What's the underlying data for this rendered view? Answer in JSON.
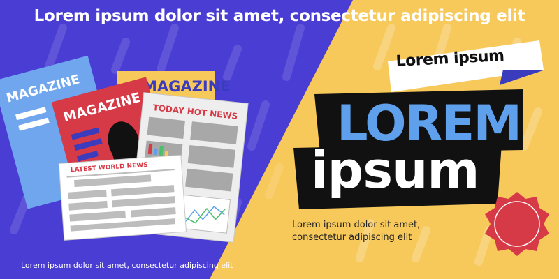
{
  "banner": {
    "headline": "Lorem ipsum dolor sit amet, consectetur adipiscing elit",
    "footer": "Lorem ipsum dolor sit amet, consectetur adipiscing elit"
  },
  "illustration": {
    "magazine_blue": "MAGAZINE",
    "magazine_red": "MAGAZINE",
    "magazine_yellow": "MAGAZINE",
    "newspaper_header": "TODAY HOT NEWS",
    "newspaper_front": "LATEST WORLD NEWS"
  },
  "promo": {
    "tag": "Lorem ipsum",
    "title_line1": "LOREM",
    "title_line2": "ipsum",
    "description_line1": "Lorem ipsum dolor sit amet,",
    "description_line2": "consectetur adipiscing elit"
  },
  "colors": {
    "left_bg": "#4a3dd4",
    "right_bg": "#f7c85a",
    "accent_blue": "#5ea0ec",
    "badge_red": "#d63a47"
  }
}
